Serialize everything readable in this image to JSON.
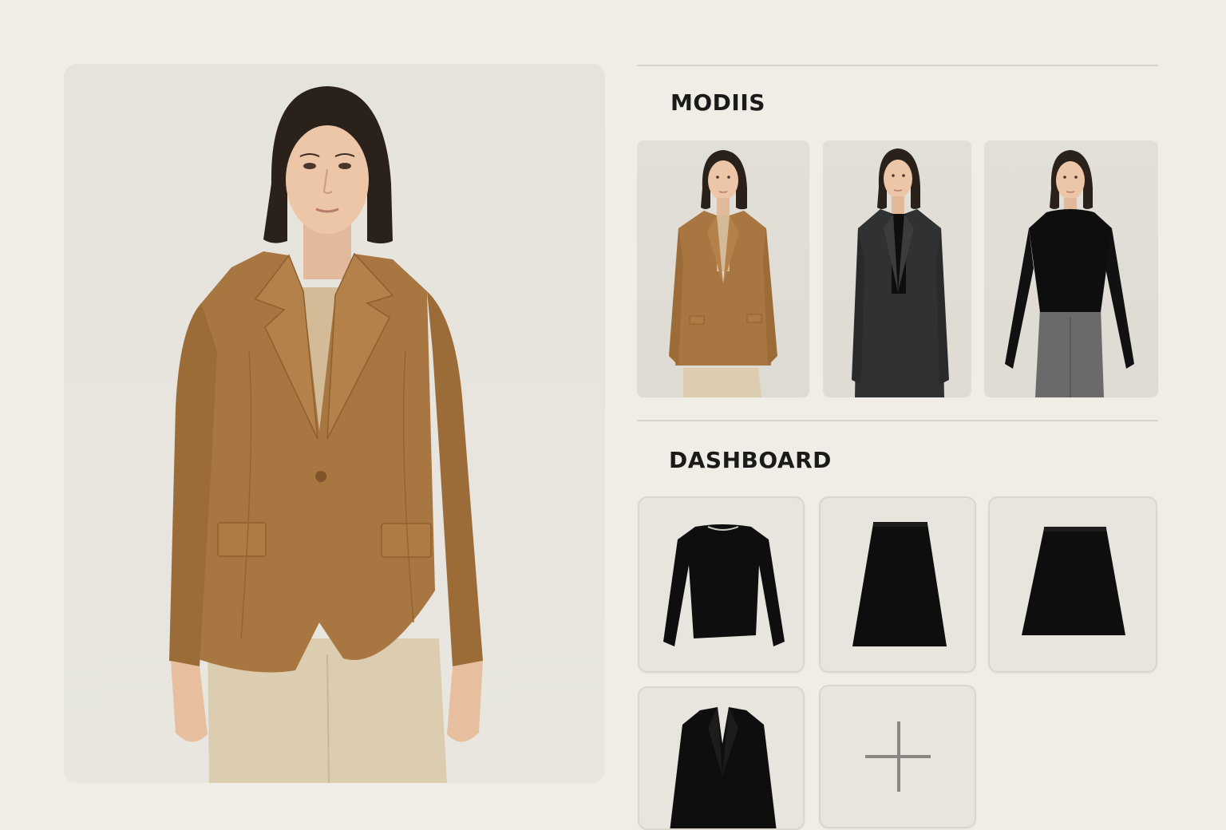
{
  "sections": {
    "models_title": "MODIIS",
    "dashboard_title": "DASHBOARD"
  },
  "models": [
    {
      "id": "model-camel-blazer",
      "outfit": "camel blazer, beige top, beige trousers"
    },
    {
      "id": "model-charcoal-coat",
      "outfit": "charcoal coat, black top"
    },
    {
      "id": "model-black-sweater",
      "outfit": "black sweater, grey trousers"
    }
  ],
  "items": [
    {
      "id": "item-black-sweater",
      "type": "sweater"
    },
    {
      "id": "item-black-skirt-long",
      "type": "skirt"
    },
    {
      "id": "item-black-skirt-short",
      "type": "skirt"
    },
    {
      "id": "item-black-blazer",
      "type": "blazer"
    }
  ],
  "add_item": {
    "icon": "plus-icon"
  },
  "colors": {
    "background": "#f0ede6",
    "camel": "#a87640",
    "beige": "#d8c8a8",
    "charcoal": "#2f3133",
    "black": "#0e0e0e",
    "grey": "#6a6a6a"
  }
}
